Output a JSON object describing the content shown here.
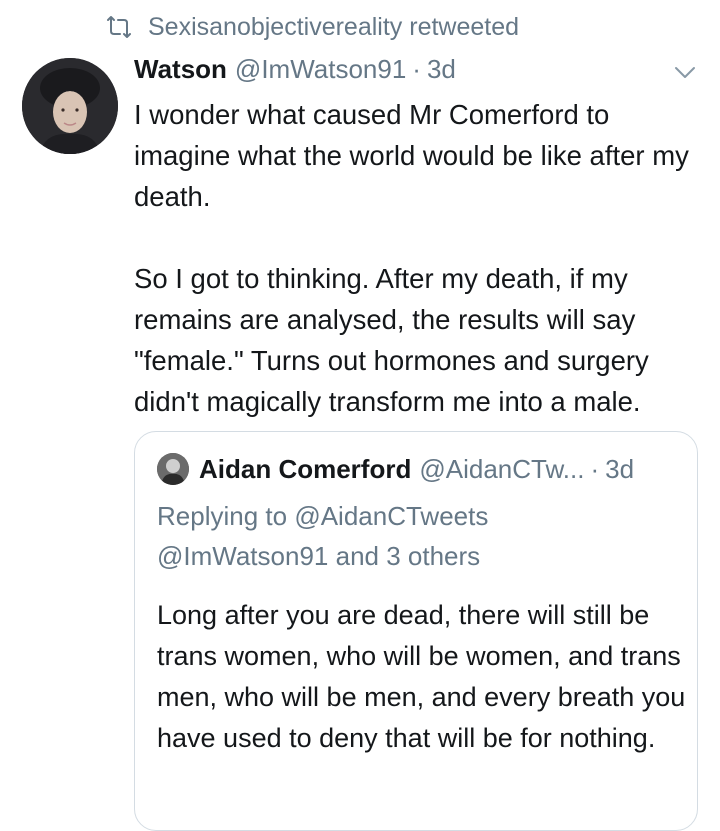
{
  "retweet": {
    "icon": "retweet-icon",
    "text": "Sexisanobjectivereality retweeted"
  },
  "tweet": {
    "name": "Watson",
    "handle": "@ImWatson91",
    "separator": "·",
    "time": "3d",
    "text": "I wonder what caused Mr Comerford to imagine what the world would be like after my death.\n\nSo I got to thinking. After my death, if my remains are analysed, the results will say \"female.\" Turns out hormones and surgery didn't magically transform me into a male.",
    "menu_icon": "chevron-down-icon"
  },
  "quote": {
    "name": "Aidan Comerford",
    "handle": "@AidanCTw...",
    "separator": "·",
    "time": "3d",
    "replying_prefix": "Replying to",
    "replying_to": "@AidanCTweets",
    "replying_also": "@ImWatson91",
    "replying_and": "and",
    "replying_others": "3 others",
    "text": "Long after you are dead, there will still be trans women, who will be women, and trans men, who will be men, and every breath you have used to deny that will be for nothing."
  },
  "colors": {
    "text": "#14171a",
    "secondary": "#657786",
    "border": "#d4dce3"
  }
}
